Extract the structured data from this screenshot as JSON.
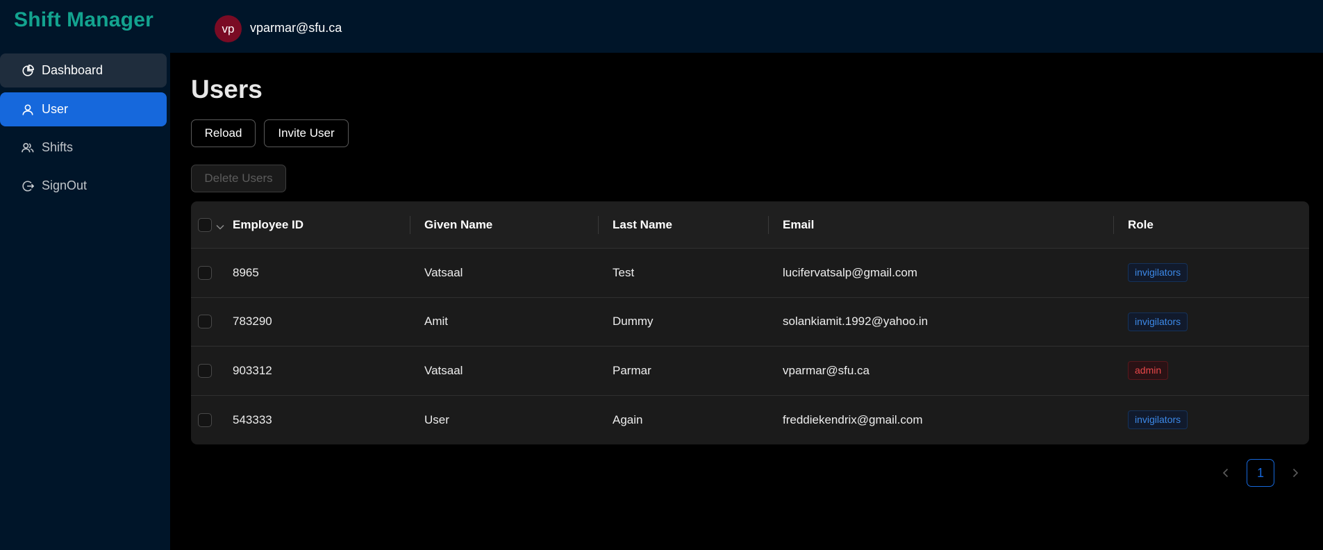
{
  "header": {
    "app_title": "Shift Manager",
    "avatar_initials": "vp",
    "user_email": "vparmar@sfu.ca",
    "bg_color": "#001529",
    "brand_color": "#13a38f",
    "avatar_color": "#7a0b24"
  },
  "sidebar": {
    "items": [
      {
        "label": "Dashboard",
        "icon": "pie-chart-icon",
        "state": "hover"
      },
      {
        "label": "User",
        "icon": "user-icon",
        "state": "active"
      },
      {
        "label": "Shifts",
        "icon": "team-icon",
        "state": "normal"
      },
      {
        "label": "SignOut",
        "icon": "logout-icon",
        "state": "normal"
      }
    ],
    "active_color": "#1668dc"
  },
  "main": {
    "title": "Users",
    "buttons": {
      "reload": "Reload",
      "invite": "Invite User",
      "delete": "Delete Users"
    },
    "table": {
      "columns": [
        "Employee ID",
        "Given Name",
        "Last Name",
        "Email",
        "Role"
      ],
      "rows": [
        {
          "id": "8965",
          "given": "Vatsaal",
          "last": "Test",
          "email": "lucifervatsalp@gmail.com",
          "role": "invigilators",
          "role_color": "blue"
        },
        {
          "id": "783290",
          "given": "Amit",
          "last": "Dummy",
          "email": "solankiamit.1992@yahoo.in",
          "role": "invigilators",
          "role_color": "blue"
        },
        {
          "id": "903312",
          "given": "Vatsaal",
          "last": "Parmar",
          "email": "vparmar@sfu.ca",
          "role": "admin",
          "role_color": "red"
        },
        {
          "id": "543333",
          "given": "User",
          "last": "Again",
          "email": "freddiekendrix@gmail.com",
          "role": "invigilators",
          "role_color": "blue"
        }
      ]
    },
    "pagination": {
      "current_page": "1"
    }
  }
}
